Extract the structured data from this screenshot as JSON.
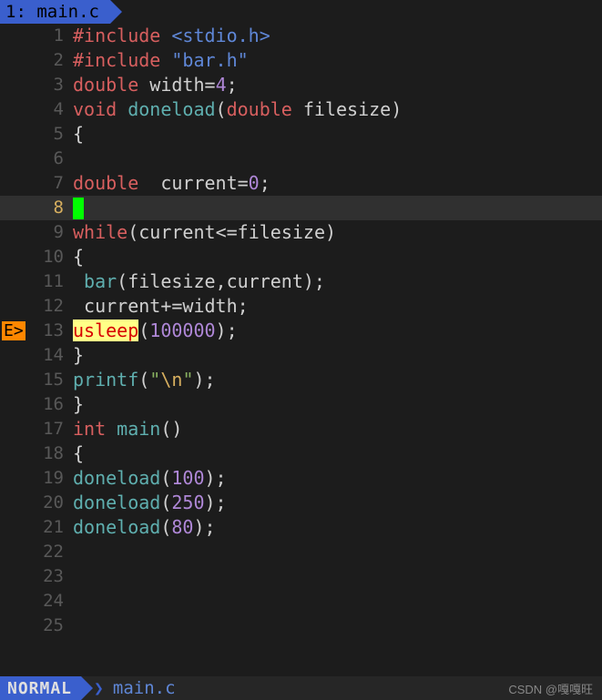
{
  "tab": {
    "index": "1:",
    "filename": "main.c"
  },
  "gutter_error": "E>",
  "cursor_line": 8,
  "error_line": 13,
  "lines": {
    "1": [
      [
        "preproc",
        "#include "
      ],
      [
        "include-str",
        "<stdio.h>"
      ]
    ],
    "2": [
      [
        "preproc",
        "#include "
      ],
      [
        "include-str",
        "\"bar.h\""
      ]
    ],
    "3": [
      [
        "type",
        "double "
      ],
      [
        "ident",
        "width"
      ],
      [
        "punc",
        "="
      ],
      [
        "num",
        "4"
      ],
      [
        "punc",
        ";"
      ]
    ],
    "4": [
      [
        "type",
        "void "
      ],
      [
        "func",
        "doneload"
      ],
      [
        "punc",
        "("
      ],
      [
        "type",
        "double "
      ],
      [
        "ident",
        "filesize"
      ],
      [
        "punc",
        ")"
      ]
    ],
    "5": [
      [
        "punc",
        "{"
      ]
    ],
    "6": [],
    "7": [
      [
        "type",
        "double  "
      ],
      [
        "ident",
        "current"
      ],
      [
        "punc",
        "="
      ],
      [
        "num",
        "0"
      ],
      [
        "punc",
        ";"
      ]
    ],
    "8": [
      [
        "cursor",
        ""
      ]
    ],
    "9": [
      [
        "key",
        "while"
      ],
      [
        "punc",
        "("
      ],
      [
        "ident",
        "current"
      ],
      [
        "punc",
        "<="
      ],
      [
        "ident",
        "filesize"
      ],
      [
        "punc",
        ")"
      ]
    ],
    "10": [
      [
        "punc",
        "{"
      ]
    ],
    "11": [
      [
        "ident",
        " "
      ],
      [
        "func",
        "bar"
      ],
      [
        "punc",
        "("
      ],
      [
        "ident",
        "filesize"
      ],
      [
        "punc",
        ","
      ],
      [
        "ident",
        "current"
      ],
      [
        "punc",
        ");"
      ]
    ],
    "12": [
      [
        "ident",
        " current"
      ],
      [
        "punc",
        "+="
      ],
      [
        "ident",
        "width"
      ],
      [
        "punc",
        ";"
      ]
    ],
    "13": [
      [
        "hl-error",
        "usleep"
      ],
      [
        "punc",
        "("
      ],
      [
        "num",
        "100000"
      ],
      [
        "punc",
        ");"
      ]
    ],
    "14": [
      [
        "punc",
        "}"
      ]
    ],
    "15": [
      [
        "func",
        "printf"
      ],
      [
        "punc",
        "("
      ],
      [
        "string",
        "\""
      ],
      [
        "escape",
        "\\n"
      ],
      [
        "string",
        "\""
      ],
      [
        "punc",
        ");"
      ]
    ],
    "16": [
      [
        "punc",
        "}"
      ]
    ],
    "17": [
      [
        "type",
        "int "
      ],
      [
        "func",
        "main"
      ],
      [
        "punc",
        "()"
      ]
    ],
    "18": [
      [
        "punc",
        "{"
      ]
    ],
    "19": [
      [
        "func",
        "doneload"
      ],
      [
        "punc",
        "("
      ],
      [
        "num",
        "100"
      ],
      [
        "punc",
        ");"
      ]
    ],
    "20": [
      [
        "func",
        "doneload"
      ],
      [
        "punc",
        "("
      ],
      [
        "num",
        "250"
      ],
      [
        "punc",
        ");"
      ]
    ],
    "21": [
      [
        "func",
        "doneload"
      ],
      [
        "punc",
        "("
      ],
      [
        "num",
        "80"
      ],
      [
        "punc",
        ");"
      ]
    ],
    "22": [],
    "23": [],
    "24": [],
    "25": []
  },
  "line_count": 25,
  "status": {
    "mode": "NORMAL",
    "filename": "main.c"
  },
  "watermark": "CSDN @嘎嘎旺"
}
